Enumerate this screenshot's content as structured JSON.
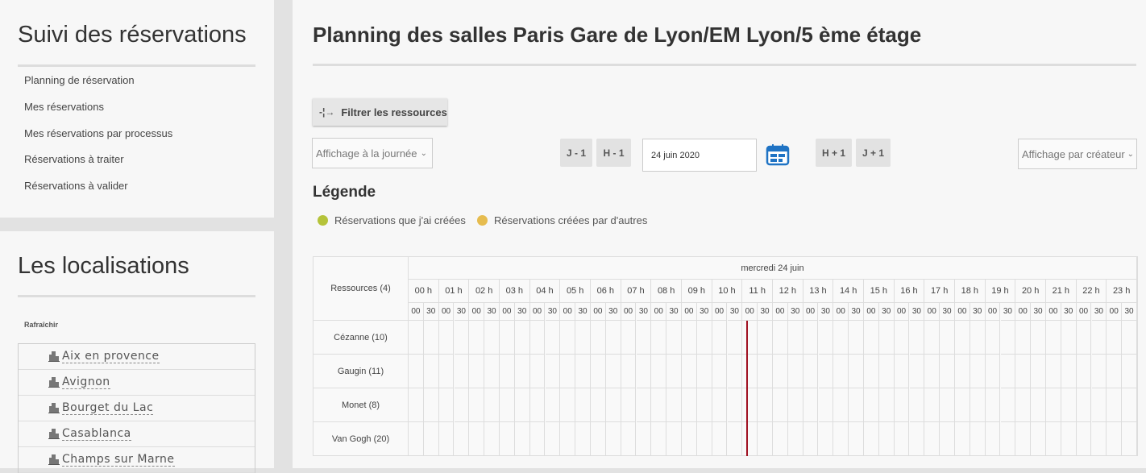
{
  "sidebar": {
    "tracking": {
      "title": "Suivi des réservations",
      "items": [
        "Planning de réservation",
        "Mes réservations",
        "Mes réservations par processus",
        "Réservations à traiter",
        "Réservations à valider"
      ]
    },
    "locations": {
      "title": "Les localisations",
      "refresh": "Rafraîchir",
      "items": [
        "Aix en provence",
        "Avignon",
        "Bourget du Lac",
        "Casablanca",
        "Champs sur Marne"
      ]
    }
  },
  "main": {
    "title": "Planning des salles Paris Gare de Lyon/EM Lyon/5 ème étage",
    "filter_button": "Filtrer les ressources",
    "view_select": "Affichage à la journée",
    "nav": {
      "day_prev": "J - 1",
      "hour_prev": "H - 1",
      "hour_next": "H + 1",
      "day_next": "J + 1"
    },
    "date": "24 juin 2020",
    "creator_select": "Affichage par créateur",
    "legend": {
      "title": "Légende",
      "items": [
        {
          "label": "Réservations que j'ai créées",
          "color": "#b5c33a"
        },
        {
          "label": "Réservations créées par d'autres",
          "color": "#e6bc4f"
        }
      ]
    },
    "planning": {
      "resources_header": "Ressources (4)",
      "day": "mercredi 24 juin",
      "hours": [
        "00 h",
        "01 h",
        "02 h",
        "03 h",
        "04 h",
        "05 h",
        "06 h",
        "07 h",
        "08 h",
        "09 h",
        "10 h",
        "11 h",
        "12 h",
        "13 h",
        "14 h",
        "15 h",
        "16 h",
        "17 h",
        "18 h",
        "19 h",
        "20 h",
        "21 h",
        "22 h",
        "23 h"
      ],
      "minutes": [
        "00",
        "30"
      ],
      "resources": [
        "Cézanne (10)",
        "Gaugin (11)",
        "Monet (8)",
        "Van Gogh (20)"
      ],
      "current_time_marker": "11:08",
      "current_time_color": "#a01020"
    }
  }
}
